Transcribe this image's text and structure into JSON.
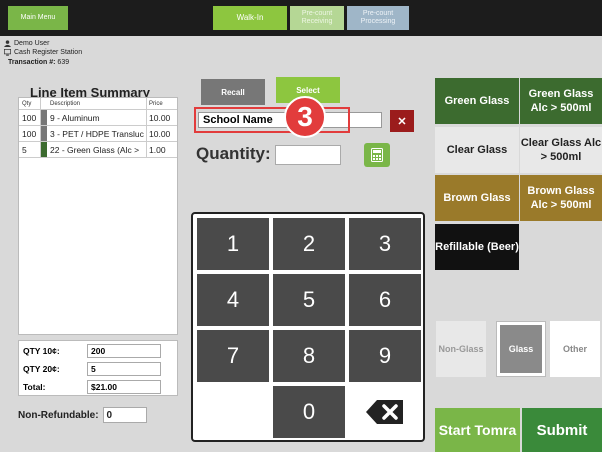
{
  "topbar": {
    "main_menu": "Main Menu",
    "walk_in": "Walk-In",
    "precount_receiving": "Pre-count Receiving",
    "precount_processing": "Pre-count Processing"
  },
  "header": {
    "user": "Demo User",
    "station": "Cash Register Station",
    "transaction_label": "Transaction #:",
    "transaction_number": "639"
  },
  "summary": {
    "title": "Line Item Summary",
    "columns": [
      "Qty",
      "Description",
      "Price"
    ],
    "rows": [
      {
        "qty": "100",
        "desc": "9 - Aluminum",
        "price": "10.00",
        "color": "#777777"
      },
      {
        "qty": "100",
        "desc": "3 - PET / HDPE Transluc",
        "price": "10.00",
        "color": "#777777"
      },
      {
        "qty": "5",
        "desc": "22 - Green Glass (Alc >",
        "price": "1.00",
        "color": "#3c6b2f"
      }
    ]
  },
  "totals": {
    "qty10_label": "QTY 10¢:",
    "qty10_value": "200",
    "qty20_label": "QTY 20¢:",
    "qty20_value": "5",
    "total_label": "Total:",
    "total_value": "$21.00"
  },
  "nonrefundable": {
    "label": "Non-Refundable:",
    "value": "0"
  },
  "actions": {
    "recall": "Recall",
    "select": "Select"
  },
  "school": {
    "value": "School Name",
    "badge": "3",
    "clear": "✕"
  },
  "quantity": {
    "label": "Quantity:",
    "value": ""
  },
  "keypad": {
    "k1": "1",
    "k2": "2",
    "k3": "3",
    "k4": "4",
    "k5": "5",
    "k6": "6",
    "k7": "7",
    "k8": "8",
    "k9": "9",
    "k0": "0"
  },
  "materials": {
    "green_glass": "Green Glass",
    "green_glass_alc": "Green Glass Alc > 500ml",
    "clear_glass": "Clear Glass",
    "clear_glass_alc": "Clear Glass Alc > 500ml",
    "brown_glass": "Brown Glass",
    "brown_glass_alc": "Brown Glass Alc > 500ml",
    "refillable": "Refillable (Beer)"
  },
  "filters": {
    "non_glass": "Non-Glass",
    "glass": "Glass",
    "other": "Other"
  },
  "bottom": {
    "start_tomra": "Start Tomra",
    "submit": "Submit"
  }
}
